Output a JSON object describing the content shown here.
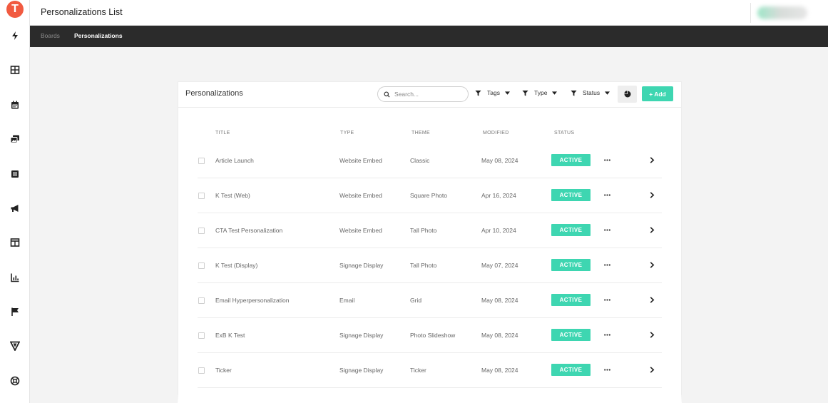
{
  "app": {
    "logo_letter": "T",
    "logo_color": "#f15a40",
    "accent_color": "#3ed6b1",
    "rail_icons": [
      "lightning-icon",
      "grid-icon",
      "calendar-icon",
      "gallery-icon",
      "list-icon",
      "megaphone-icon",
      "layout-icon",
      "chart-icon",
      "flag-icon",
      "brand-v-icon",
      "help-lifebuoy-icon"
    ]
  },
  "header": {
    "title": "Personalizations List"
  },
  "breadcrumb": {
    "items": [
      "Boards",
      "Personalizations"
    ]
  },
  "card": {
    "title": "Personalizations",
    "search_placeholder": "Search...",
    "filters": [
      "Tags",
      "Type",
      "Status"
    ],
    "add_label": "+ Add"
  },
  "table": {
    "columns": [
      "TITLE",
      "TYPE",
      "THEME",
      "MODIFIED",
      "STATUS"
    ],
    "rows": [
      {
        "title": "Article Launch",
        "type": "Website Embed",
        "theme": "Classic",
        "modified": "May 08, 2024",
        "status": "ACTIVE"
      },
      {
        "title": "K Test (Web)",
        "type": "Website Embed",
        "theme": "Square Photo",
        "modified": "Apr 16, 2024",
        "status": "ACTIVE"
      },
      {
        "title": "CTA Test Personalization",
        "type": "Website Embed",
        "theme": "Tall Photo",
        "modified": "Apr 10, 2024",
        "status": "ACTIVE"
      },
      {
        "title": "K Test (Display)",
        "type": "Signage Display",
        "theme": "Tall Photo",
        "modified": "May 07, 2024",
        "status": "ACTIVE"
      },
      {
        "title": "Email Hyperpersonalization",
        "type": "Email",
        "theme": "Grid",
        "modified": "May 08, 2024",
        "status": "ACTIVE"
      },
      {
        "title": "ExB K Test",
        "type": "Signage Display",
        "theme": "Photo Slideshow",
        "modified": "May 08, 2024",
        "status": "ACTIVE"
      },
      {
        "title": "Ticker",
        "type": "Signage Display",
        "theme": "Ticker",
        "modified": "May 08, 2024",
        "status": "ACTIVE"
      }
    ]
  }
}
